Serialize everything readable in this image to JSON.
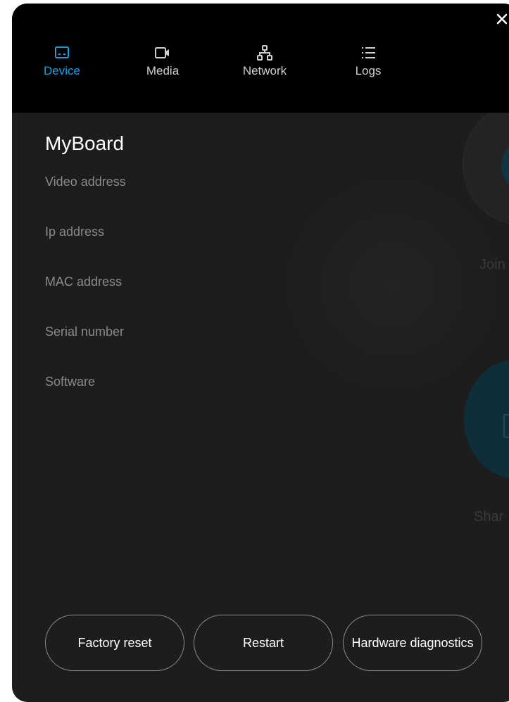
{
  "tabs": [
    {
      "label": "Device",
      "icon": "device-icon",
      "active": true
    },
    {
      "label": "Media",
      "icon": "video-camera-icon",
      "active": false
    },
    {
      "label": "Network",
      "icon": "network-icon",
      "active": false
    },
    {
      "label": "Logs",
      "icon": "list-icon",
      "active": false
    }
  ],
  "device": {
    "name": "MyBoard",
    "fields": [
      "Video address",
      "Ip address",
      "MAC address",
      "Serial number",
      "Software"
    ]
  },
  "actions": {
    "factory_reset": "Factory reset",
    "restart": "Restart",
    "hardware_diagnostics": "Hardware diagnostics"
  },
  "background": {
    "join_label": "Join",
    "share_label": "Shar"
  },
  "colors": {
    "accent": "#18a2e8",
    "panel": "#1d1d1d",
    "header": "#000000"
  }
}
